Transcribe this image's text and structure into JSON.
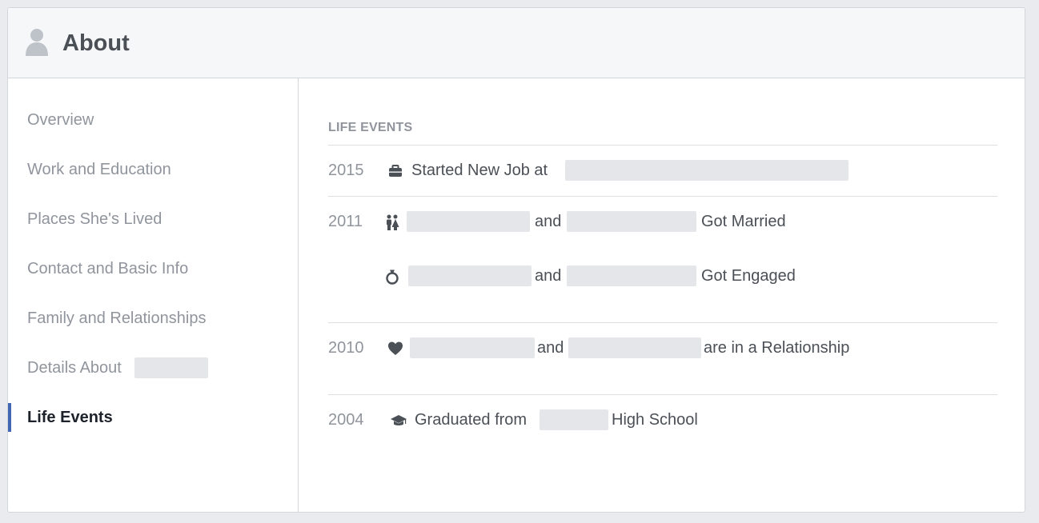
{
  "header": {
    "title": "About",
    "icon": "person-icon"
  },
  "sidebar": {
    "items": [
      {
        "label": "Overview"
      },
      {
        "label": "Work and Education"
      },
      {
        "label": "Places She's Lived"
      },
      {
        "label": "Contact and Basic Info"
      },
      {
        "label": "Family and Relationships"
      },
      {
        "label": "Details About"
      },
      {
        "label": "Life Events",
        "active": true
      }
    ],
    "active_color": "#4267b2"
  },
  "main": {
    "section_title": "LIFE EVENTS",
    "events": [
      {
        "year": "2015",
        "icon": "briefcase-icon",
        "text": "Started New Job at"
      },
      {
        "year": "2011",
        "icon": "couple-icon",
        "joiner": "and",
        "suffix": "Got Married"
      },
      {
        "icon": "ring-icon",
        "joiner": "and",
        "suffix": "Got Engaged"
      },
      {
        "year": "2010",
        "icon": "heart-icon",
        "joiner": "and",
        "suffix": "are in a Relationship"
      },
      {
        "year": "2004",
        "icon": "graduation-cap-icon",
        "prefix": "Graduated from",
        "suffix": "High School"
      }
    ]
  }
}
